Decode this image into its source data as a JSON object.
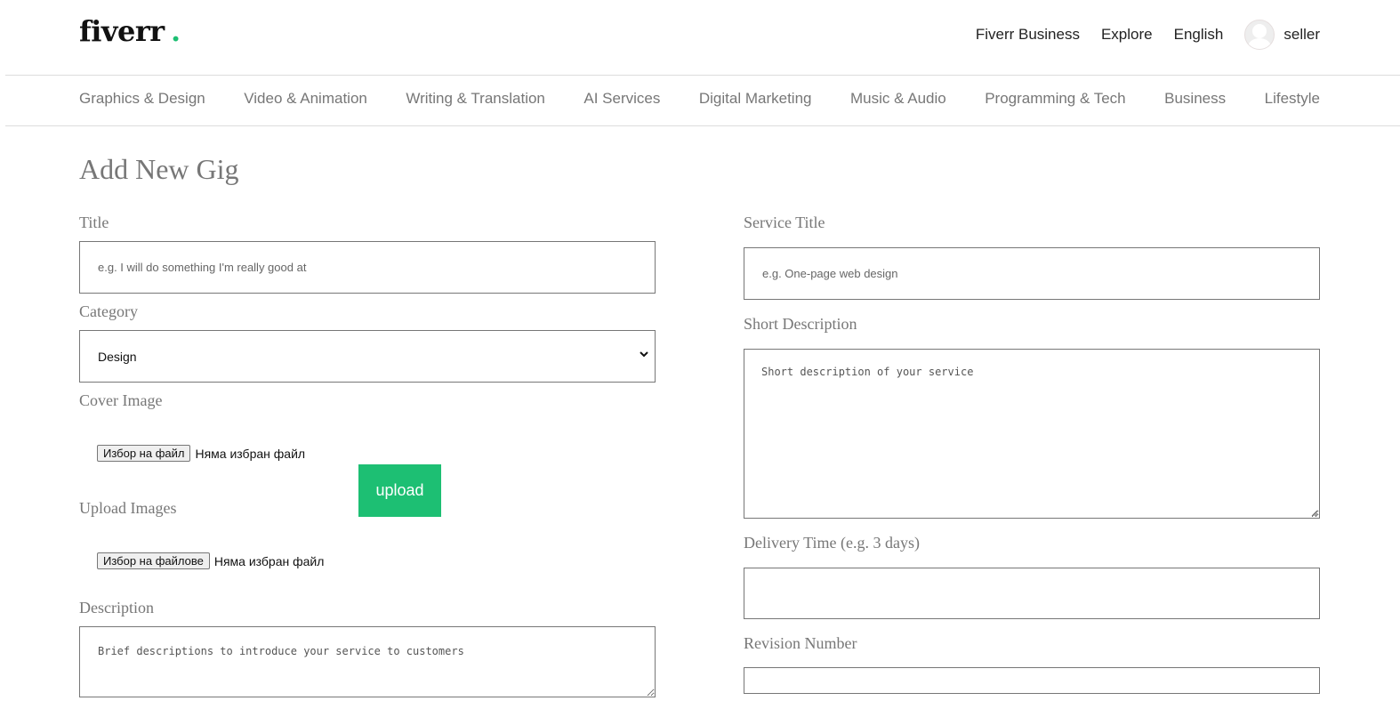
{
  "header": {
    "logo": "fiverr",
    "logo_dot": ".",
    "nav": {
      "business": "Fiverr Business",
      "explore": "Explore",
      "language": "English",
      "username": "seller"
    }
  },
  "categories": [
    "Graphics & Design",
    "Video & Animation",
    "Writing & Translation",
    "AI Services",
    "Digital Marketing",
    "Music & Audio",
    "Programming & Tech",
    "Business",
    "Lifestyle"
  ],
  "form": {
    "page_title": "Add New Gig",
    "title_label": "Title",
    "title_placeholder": "e.g. I will do something I'm really good at",
    "category_label": "Category",
    "category_selected": "Design",
    "cover_label": "Cover Image",
    "cover_button": "Избор на файл",
    "cover_status": "Няма избран файл",
    "upload_button": "upload",
    "images_label": "Upload Images",
    "images_button": "Избор на файлове",
    "images_status": "Няма избран файл",
    "description_label": "Description",
    "description_placeholder": "Brief descriptions to introduce your service to customers",
    "service_title_label": "Service Title",
    "service_title_placeholder": "e.g. One-page web design",
    "short_desc_label": "Short Description",
    "short_desc_placeholder": "Short description of your service",
    "delivery_label": "Delivery Time (e.g. 3 days)",
    "delivery_value": "",
    "revision_label": "Revision Number"
  },
  "colors": {
    "brand_green": "#1dbf73",
    "muted_text": "#777777"
  }
}
